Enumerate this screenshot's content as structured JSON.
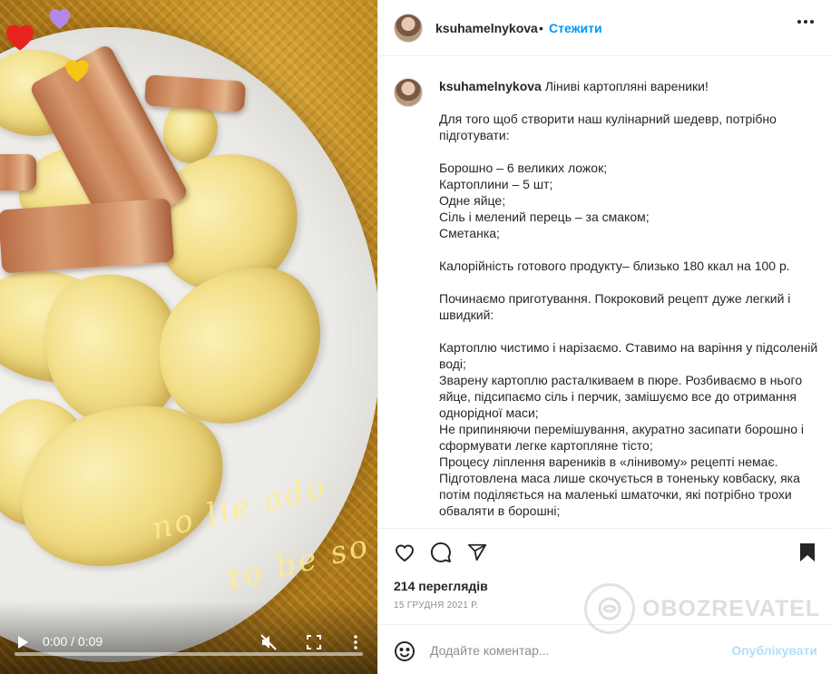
{
  "media": {
    "overlay_text_1": "no lie ado",
    "overlay_text_2": "to be so",
    "time": "0:00 / 0:09",
    "progress": 0,
    "icons": [
      "heart-red-icon",
      "heart-purple-icon",
      "heart-yellow-icon",
      "play-icon",
      "mute-icon",
      "fullscreen-icon",
      "more-vertical-icon"
    ],
    "colors": {
      "heart_red": "#e8231d",
      "heart_purple": "#b489e6",
      "heart_yellow": "#f5c518"
    }
  },
  "header": {
    "username": "ksuhamelnykova",
    "separator": "•",
    "follow_label": "Стежити"
  },
  "caption": {
    "username": "ksuhamelnykova",
    "title": "Ліниві картопляні вареники!",
    "paragraphs": [
      "Для того щоб створити наш кулінарний шедевр, потрібно підготувати:",
      "Борошно – 6 великих ложок;\nКартоплини – 5 шт;\nОдне яйце;\nСіль і мелений перець – за смаком;\nСметанка;",
      "Калорійність готового продукту– близько 180 ккал на 100 р.",
      "Починаємо приготування. Покроковий рецепт дуже легкий і швидкий:",
      "Картоплю чистимо і нарізаємо. Ставимо на варіння у підсоленій воді;\nЗварену картоплю расталкиваем в пюре. Розбиваємо в нього яйце, підсипаємо сіль і перчик, замішуємо все до отримання однорідної маси;\nНе припиняючи перемішування, акуратно засипати борошно і сформувати легке картопляне тісто;\nПроцесу ліплення вареників в «лінивому» рецепті немає. Підготовлена маса лише скочується в тоненьку ковбаску, яка потім поділяється на маленькі шматочки, які потрібно трохи обваляти в борошні;"
    ]
  },
  "actions": {
    "icons": [
      "heart-icon",
      "comment-icon",
      "share-icon",
      "bookmark-icon"
    ],
    "views": "214 переглядів",
    "date": "15 ГРУДНЯ 2021 Р."
  },
  "comment": {
    "placeholder": "Додайте коментар...",
    "publish_label": "Опублікувати",
    "emoji_icon": "emoji-icon"
  },
  "watermark": {
    "text": "OBOZREVATEL"
  },
  "colors": {
    "link": "#0095f6",
    "publish_disabled": "#b2dffc",
    "text": "#262626",
    "muted": "#8e8e8e"
  }
}
